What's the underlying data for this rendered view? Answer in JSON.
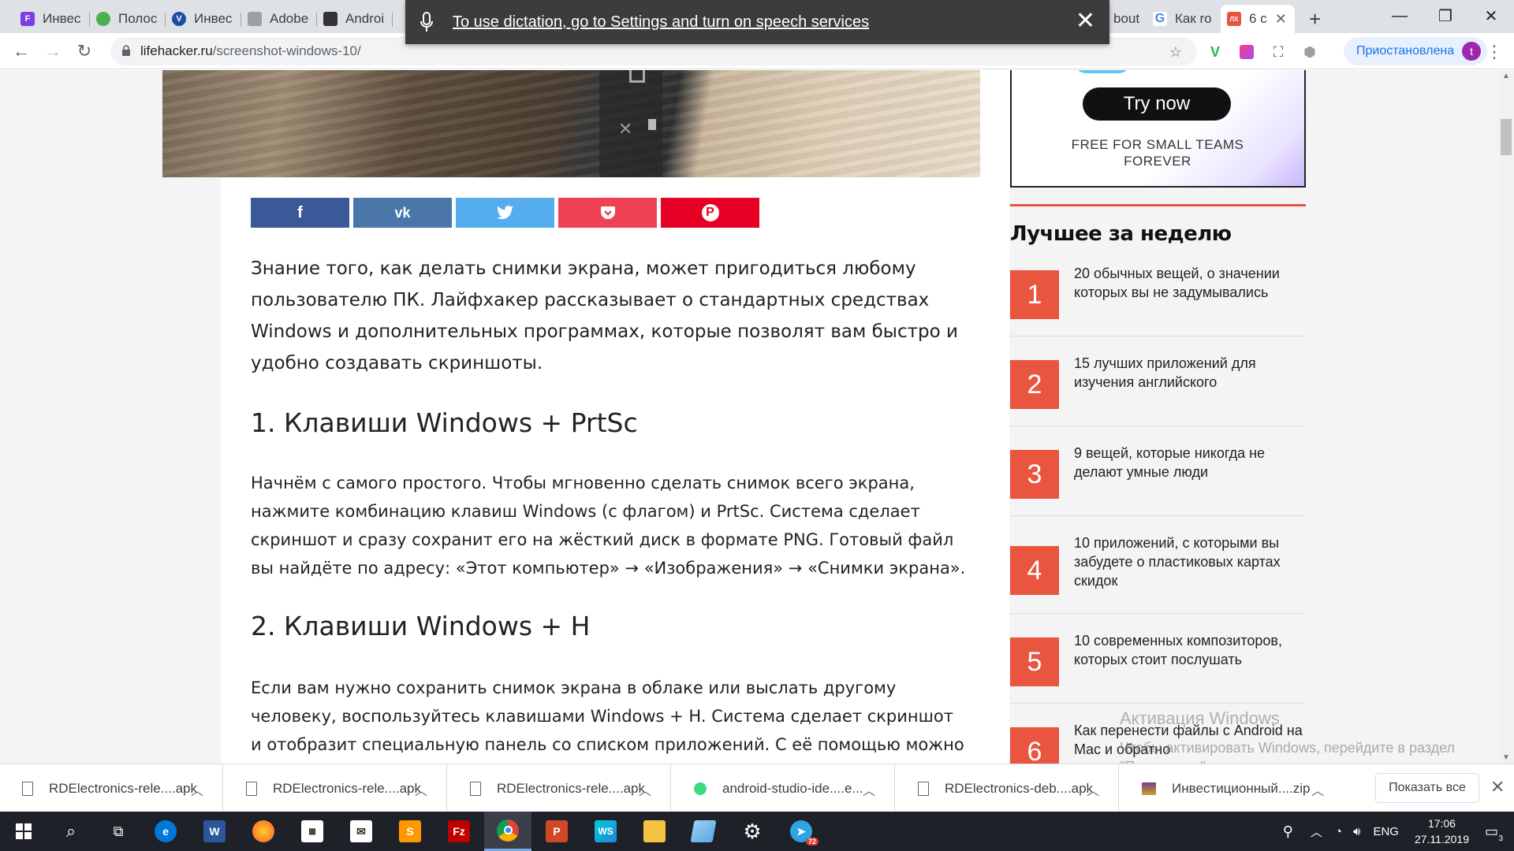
{
  "tabs": [
    {
      "label": "Инвес",
      "color": "#7b3fe4"
    },
    {
      "label": "Полос",
      "color": "#4caf50"
    },
    {
      "label": "Инвес",
      "color": "#1a4fa0"
    },
    {
      "label": "Adobe",
      "color": "#5f6368"
    },
    {
      "label": "Androi",
      "color": "#333333"
    },
    {
      "label": "",
      "color": "#777777"
    },
    {
      "label": "bout",
      "color": "#777777"
    },
    {
      "label": "Как ro",
      "color": "#4285f4"
    },
    {
      "label": "6 c",
      "color": "#e8533f"
    }
  ],
  "dictation": {
    "message": "To use dictation, go to Settings and turn on speech services"
  },
  "address": {
    "host": "lifehacker.ru",
    "path": "/screenshot-windows-10/"
  },
  "profile": {
    "label": "Приостановлена",
    "avatar": "t"
  },
  "share_colors": [
    "#3b5998",
    "#4a76a8",
    "#55acee",
    "#ef4056",
    "#e60023"
  ],
  "article": {
    "lead": "Знание того, как делать снимки экрана, может пригодиться любому пользователю ПК. Лайфхакер рассказывает о стандартных средствах Windows и дополнительных программах, которые позволят вам быстро и удобно создавать скриншоты.",
    "h1": "1. Клавиши Windows + PrtSc",
    "p1": "Начнём с самого простого. Чтобы мгновенно сделать снимок всего экрана, нажмите комбинацию клавиш Windows (с флагом) и PrtSc. Система сделает скриншот и сразу сохранит его на жёсткий диск в формате PNG. Готовый файл вы найдёте по адресу: «Этот компьютер» → «Изображения» → «Снимки экрана».",
    "h2": "2. Клавиши Windows + H",
    "p2": "Если вам нужно сохранить снимок экрана в облаке или выслать другому человеку, воспользуйтесь клавишами Windows + H. Система сделает скриншот и отобразит специальную панель со списком приложений. С её помощью можно отправить"
  },
  "ad": {
    "button": "Try now",
    "tagline": "FREE FOR SMALL TEAMS FOREVER"
  },
  "sidebar": {
    "title": "Лучшее за неделю",
    "items": [
      {
        "num": "1",
        "text": "20 обычных вещей, о значении которых вы не задумывались"
      },
      {
        "num": "2",
        "text": "15 лучших приложений для изучения английского"
      },
      {
        "num": "3",
        "text": "9 вещей, которые никогда не делают умные люди"
      },
      {
        "num": "4",
        "text": "10 приложений, с которыми вы забудете о пластиковых картах скидок"
      },
      {
        "num": "5",
        "text": "10 современных композиторов, которых стоит послушать"
      },
      {
        "num": "6",
        "text": "Как перенести файлы с Android на Mac и обратно"
      }
    ]
  },
  "watermark": {
    "line1": "Активация Windows",
    "line2": "Чтобы активировать Windows, перейдите в раздел \"Параметры\"."
  },
  "downloads": [
    {
      "name": "RDElectronics-rele....apk"
    },
    {
      "name": "RDElectronics-rele....apk"
    },
    {
      "name": "RDElectronics-rele....apk"
    },
    {
      "name": "android-studio-ide....e..."
    },
    {
      "name": "RDElectronics-deb....apk"
    },
    {
      "name": "Инвестиционный....zip"
    }
  ],
  "show_all": "Показать все",
  "tray": {
    "lang": "ENG",
    "time": "17:06",
    "date": "27.11.2019",
    "notif": "3"
  },
  "taskbar_badge": "72"
}
